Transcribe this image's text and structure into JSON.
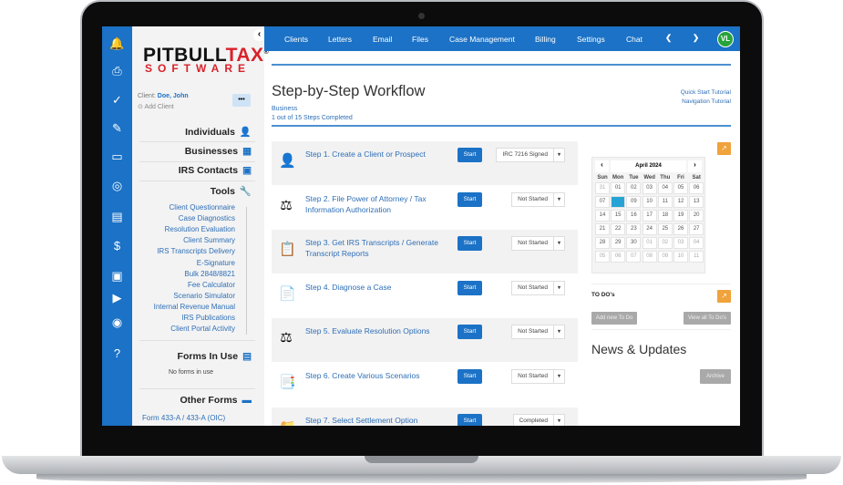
{
  "sidebar_icons": [
    "bell-icon",
    "printer-icon",
    "check-circle-icon",
    "pencil-icon",
    "id-card-icon",
    "compass-icon",
    "report-icon",
    "dollar-document-icon",
    "briefcase-icon",
    "video-icon",
    "lifebuoy-icon",
    "help-icon"
  ],
  "logo": {
    "line1a": "PITBULL",
    "line1b": "TAX",
    "reg": "®",
    "line2": "SOFTWARE"
  },
  "client": {
    "label": "Client:",
    "name": "Doe, John",
    "add": "Add Client",
    "more": "•••"
  },
  "sections": {
    "individuals": "Individuals",
    "businesses": "Businesses",
    "irs_contacts": "IRS Contacts",
    "tools": "Tools",
    "forms_in_use": "Forms In Use",
    "no_forms": "No forms in use",
    "other_forms": "Other Forms",
    "form_433": "Form 433-A / 433-A (OIC)"
  },
  "tools": [
    "Client Questionnaire",
    "Case Diagnostics",
    "Resolution Evaluation",
    "Client Summary",
    "IRS Transcripts Delivery",
    "E-Signature",
    "Bulk 2848/8821",
    "Fee Calculator",
    "Scenario Simulator",
    "Internal Revenue Manual",
    "IRS Publications",
    "Client Portal Activity"
  ],
  "nav": {
    "items": [
      "Clients",
      "Letters",
      "Email",
      "Files",
      "Case Management",
      "Billing",
      "Settings",
      "Chat"
    ],
    "prev": "❮",
    "next": "❯",
    "avatar": "VL",
    "collapse": "‹"
  },
  "main": {
    "title": "Step-by-Step Workflow",
    "type": "Business",
    "progress": "1 out of 15 Steps Completed",
    "quick_start": "Quick Start Tutorial",
    "nav_tutorial": "Navigation Tutorial"
  },
  "steps": [
    {
      "label": "Step 1. Create a Client or Prospect",
      "status": "IRC 7216 Signed",
      "icon": "👤"
    },
    {
      "label": "Step 2. File Power of Attorney / Tax Information Authorization",
      "status": "Not Started",
      "icon": "⚖"
    },
    {
      "label": "Step 3. Get IRS Transcripts / Generate Transcript Reports",
      "status": "Not Started",
      "icon": "📋"
    },
    {
      "label": "Step 4. Diagnose a Case",
      "status": "Not Started",
      "icon": "📄"
    },
    {
      "label": "Step 5. Evaluate Resolution Options",
      "status": "Not Started",
      "icon": "⚖"
    },
    {
      "label": "Step 6. Create Various Scenarios",
      "status": "Not Started",
      "icon": "📑"
    },
    {
      "label": "Step 7. Select Settlement Option",
      "status": "Completed",
      "icon": "📁"
    }
  ],
  "start_label": "Start",
  "calendar": {
    "month": "April 2024",
    "prev": "‹",
    "next": "›",
    "days": [
      "Sun",
      "Mon",
      "Tue",
      "Wed",
      "Thu",
      "Fri",
      "Sat"
    ],
    "dates": [
      "31",
      "01",
      "02",
      "03",
      "04",
      "05",
      "06",
      "07",
      "08",
      "09",
      "10",
      "11",
      "12",
      "13",
      "14",
      "15",
      "16",
      "17",
      "18",
      "19",
      "20",
      "21",
      "22",
      "23",
      "24",
      "25",
      "26",
      "27",
      "28",
      "29",
      "30",
      "01",
      "02",
      "03",
      "04",
      "05",
      "06",
      "07",
      "08",
      "09",
      "10",
      "11"
    ],
    "selected": "08"
  },
  "todo": {
    "title": "TO DO's",
    "add": "Add new To Do",
    "view": "View all To Do's"
  },
  "news": {
    "title": "News & Updates",
    "archive": "Archive"
  },
  "colors": {
    "brand_blue": "#1b72c6",
    "logo_red": "#d9222a",
    "accent_orange": "#f0a23b",
    "avatar_green": "#27a33b"
  }
}
